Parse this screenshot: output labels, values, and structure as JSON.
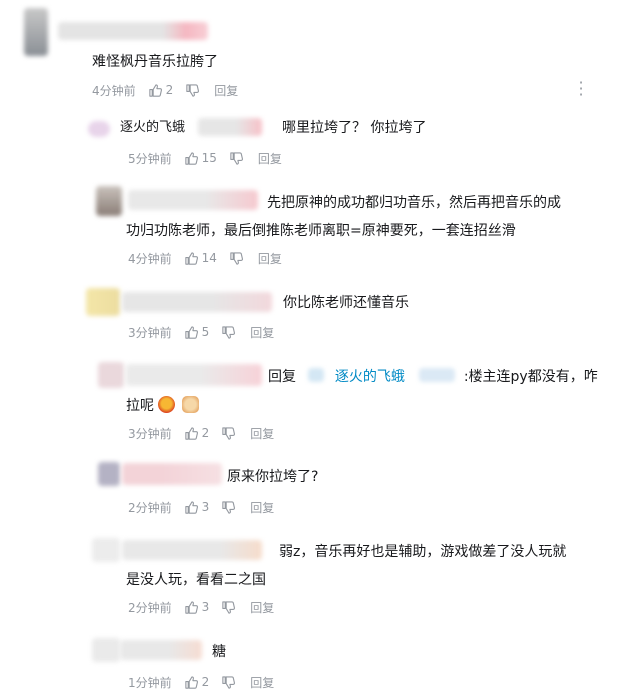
{
  "main_comment": {
    "text": "难怪枫丹音乐拉胯了",
    "time": "4分钟前",
    "likes": "2",
    "reply_label": "回复"
  },
  "replies": [
    {
      "user": "逐火的飞蛾",
      "text": "哪里拉垮了？ 你拉垮了",
      "time": "5分钟前",
      "likes": "15",
      "reply_label": "回复"
    },
    {
      "text_line1": "先把原神的成功都归功音乐，然后再把音乐的成",
      "text_line2": "功归功陈老师，最后倒推陈老师离职=原神要死，一套连招丝滑",
      "time": "4分钟前",
      "likes": "14",
      "reply_label": "回复"
    },
    {
      "text": "你比陈老师还懂音乐",
      "time": "3分钟前",
      "likes": "5",
      "reply_label": "回复"
    },
    {
      "prefix": "回复",
      "mention": "逐火的飞蛾",
      "text_after": ":楼主连py都没有，咋",
      "text_line2": "拉呢",
      "time": "3分钟前",
      "likes": "2",
      "reply_label": "回复"
    },
    {
      "text": "原来你拉垮了?",
      "time": "2分钟前",
      "likes": "3",
      "reply_label": "回复"
    },
    {
      "text_line1": "弱z，音乐再好也是辅助，游戏做差了没人玩就",
      "text_line2": "是没人玩，看看二之国",
      "time": "2分钟前",
      "likes": "3",
      "reply_label": "回复"
    },
    {
      "text": "糖",
      "time": "1分钟前",
      "likes": "2",
      "reply_label": "回复"
    }
  ],
  "icons": {
    "like": "thumbs-up-icon",
    "dislike": "thumbs-down-icon",
    "more": "more-vertical-icon"
  },
  "colors": {
    "meta_text": "#9499a0",
    "mention": "#008ac5"
  }
}
